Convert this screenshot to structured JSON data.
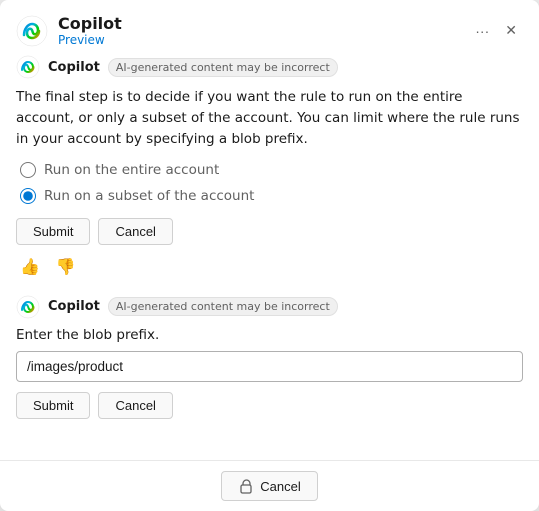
{
  "header": {
    "title": "Copilot",
    "subtitle": "Preview",
    "more_label": "···",
    "close_label": "✕"
  },
  "messages": [
    {
      "sender": "Copilot",
      "badge": "AI-generated content may be incorrect",
      "text": "The final step is to decide if you want the rule to run on the entire account, or only a subset of the account. You can limit where the rule runs in your account by specifying a blob prefix.",
      "radio_options": [
        {
          "id": "entire",
          "label": "Run on the entire account",
          "checked": false
        },
        {
          "id": "subset",
          "label": "Run on a subset of the account",
          "checked": true
        }
      ],
      "submit_label": "Submit",
      "cancel_label": "Cancel"
    },
    {
      "sender": "Copilot",
      "badge": "AI-generated content may be incorrect",
      "input_label": "Enter the blob prefix.",
      "input_placeholder": "",
      "input_value": "/images/product",
      "submit_label": "Submit",
      "cancel_label": "Cancel"
    }
  ],
  "footer": {
    "cancel_label": "Cancel",
    "cancel_icon": "🔒"
  },
  "feedback": {
    "thumbs_up": "👍",
    "thumbs_down": "👎"
  }
}
